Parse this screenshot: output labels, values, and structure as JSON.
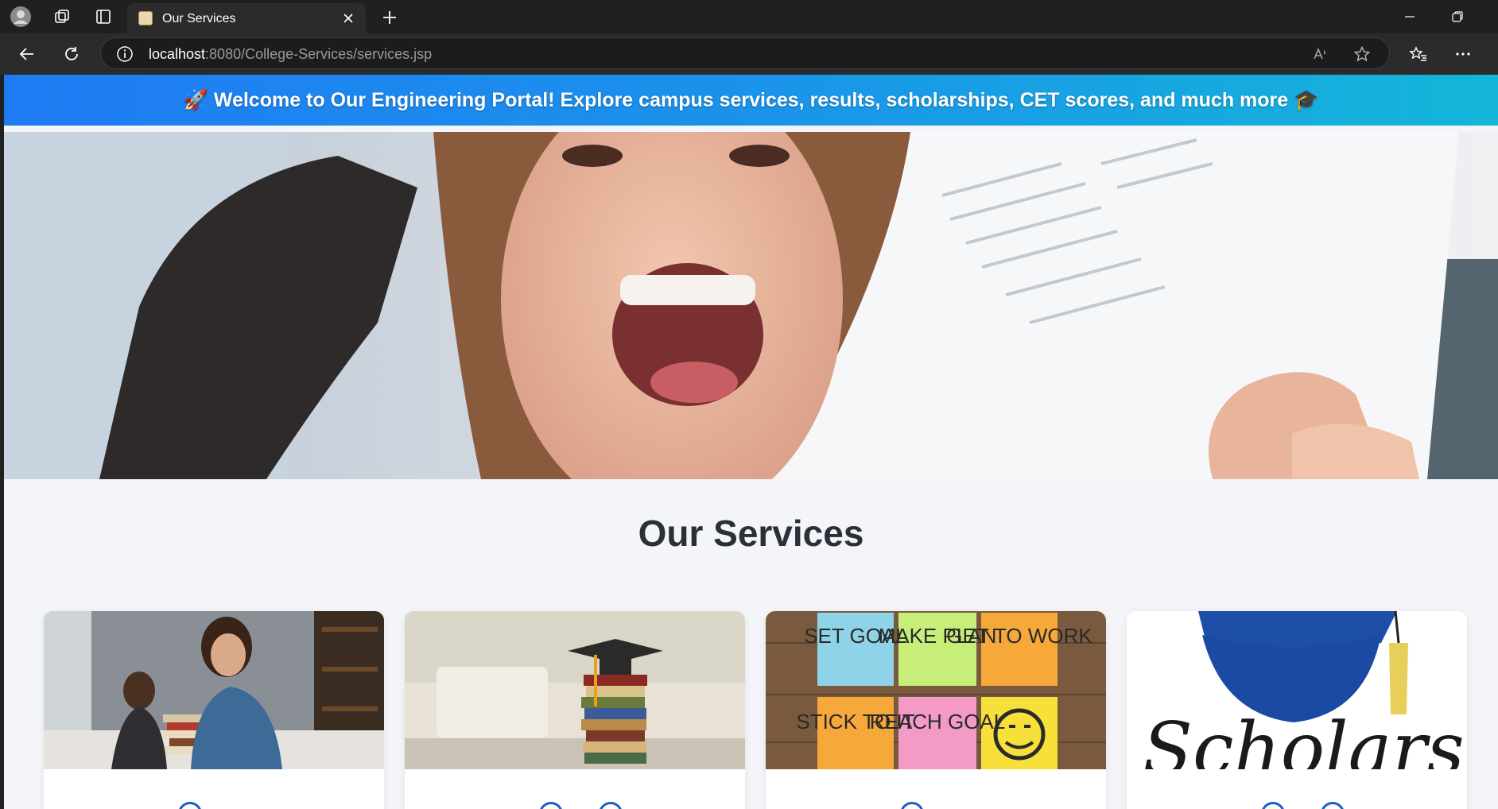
{
  "browser": {
    "tab_title": "Our Services",
    "url_host": "localhost",
    "url_path": ":8080/College-Services/services.jsp",
    "icons": {
      "profile": "profile-icon",
      "workspaces": "workspaces-icon",
      "tab_actions": "tab-actions-icon",
      "close": "close-icon",
      "new_tab": "plus-icon",
      "minimize": "minimize-icon",
      "restore": "restore-icon",
      "back": "back-arrow-icon",
      "refresh": "refresh-icon",
      "site_info": "info-icon",
      "read_aloud": "read-aloud-icon",
      "favorite": "star-icon",
      "favorites_bar": "favorites-icon",
      "more": "more-icon"
    }
  },
  "page": {
    "banner_text": "🚀 Welcome to Our Engineering Portal! Explore campus services, results, scholarships, CET scores, and much more 🎓",
    "section_title": "Our Services",
    "cards": [
      {
        "image": "student-library-photo"
      },
      {
        "image": "graduation-books-photo"
      },
      {
        "image": "sticky-notes-photo",
        "notes": [
          "SET GOAL",
          "MAKE PLAN",
          "GET TO WORK",
          "STICK TO IT",
          "REACH GOAL"
        ]
      },
      {
        "image": "scholarships-photo",
        "caption": "Scholarships"
      }
    ],
    "colors": {
      "banner_start": "#1f7bf3",
      "banner_end": "#14b6d9",
      "page_bg": "#f4f5f8",
      "title": "#2b2f38",
      "icon_blue": "#1a5fc4"
    }
  }
}
